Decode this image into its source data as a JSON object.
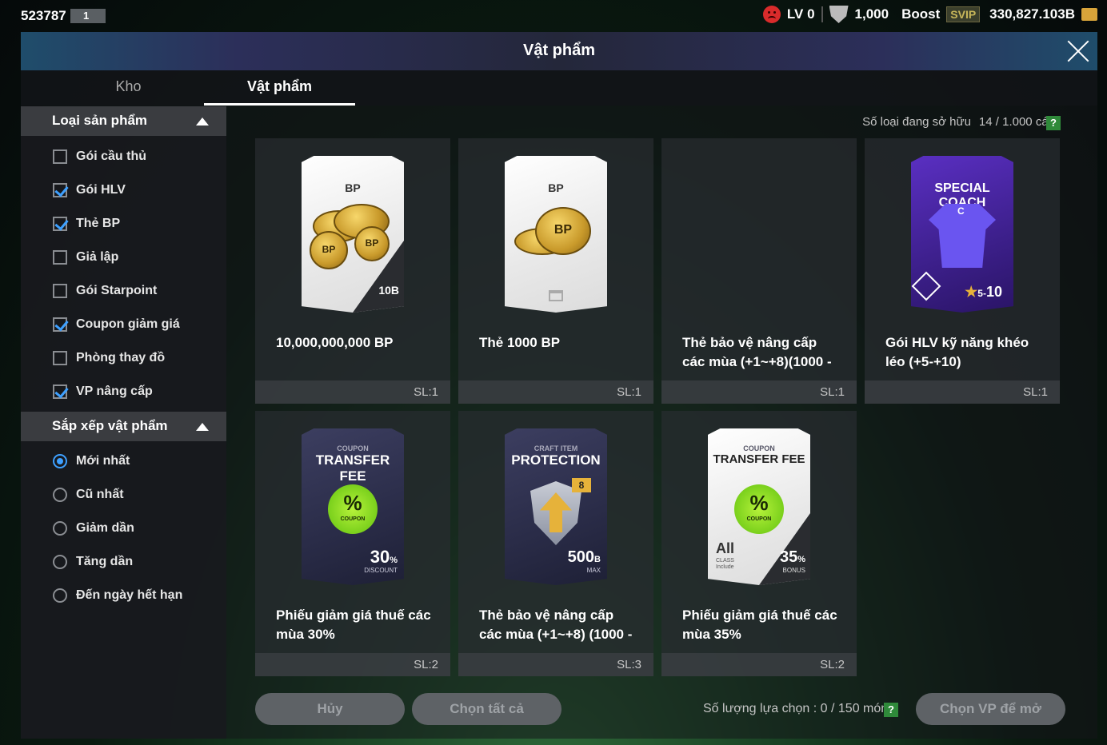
{
  "topbar": {
    "user_id": "523787",
    "slot": "1",
    "level": "LV 0",
    "trophy_count": "1,000",
    "boost_label": "Boost",
    "svip_label": "SVIP",
    "bp_balance": "330,827.103B"
  },
  "window": {
    "title": "Vật phẩm"
  },
  "tabs": [
    {
      "label": "Kho"
    },
    {
      "label": "Vật phẩm"
    }
  ],
  "filter": {
    "title": "Loại sản phẩm",
    "options": [
      {
        "label": "Gói cầu thủ",
        "checked": false
      },
      {
        "label": "Gói HLV",
        "checked": true
      },
      {
        "label": "Thẻ BP",
        "checked": true
      },
      {
        "label": "Giả lập",
        "checked": false
      },
      {
        "label": "Gói Starpoint",
        "checked": false
      },
      {
        "label": "Coupon giảm giá",
        "checked": true
      },
      {
        "label": "Phòng thay đồ",
        "checked": false
      },
      {
        "label": "VP nâng cấp",
        "checked": true
      }
    ]
  },
  "sort": {
    "title": "Sắp xếp vật phẩm",
    "options": [
      {
        "label": "Mới nhất",
        "selected": true
      },
      {
        "label": "Cũ nhất",
        "selected": false
      },
      {
        "label": "Giảm dần",
        "selected": false
      },
      {
        "label": "Tăng dần",
        "selected": false
      },
      {
        "label": "Đến ngày hết hạn",
        "selected": false
      }
    ]
  },
  "ownership": {
    "label": "Số loại đang sở hữu",
    "value": "14 / 1.000 cái",
    "help": "?"
  },
  "items": [
    {
      "name": "10,000,000,000 BP",
      "qty": "SL:1",
      "art_top": "BP",
      "art_value": "10B",
      "coin_text": "BP"
    },
    {
      "name": "Thẻ 1000 BP",
      "qty": "SL:1",
      "art_top": "BP",
      "coin_text": "BP"
    },
    {
      "name": "Thẻ bảo vệ nâng cấp các mùa (+1~+8)(1000 -",
      "qty": "SL:1"
    },
    {
      "name": "Gói HLV kỹ năng khéo léo (+5-+10)",
      "qty": "SL:1",
      "art_top": "SPECIAL COACH",
      "art_shirt_letter": "C",
      "art_range_small": "5-",
      "art_range": "10"
    },
    {
      "name": "Phiếu giảm giá thuế các mùa 30%",
      "qty": "SL:2",
      "art_small": "COUPON",
      "art_top": "TRANSFER FEE",
      "badge": "%",
      "badge_sub": "COUPON",
      "art_value": "30",
      "art_unit": "%",
      "art_sub": "DISCOUNT"
    },
    {
      "name": "Thẻ bảo vệ nâng cấp các mùa (+1~+8) (1000 -",
      "qty": "SL:3",
      "art_small": "CRAFT ITEM",
      "art_top": "PROTECTION",
      "art_tag": "8",
      "art_value": "500",
      "art_unit": "B",
      "art_sub": "MAX"
    },
    {
      "name": "Phiếu giảm giá thuế các mùa 35%",
      "qty": "SL:2",
      "art_small": "COUPON",
      "art_top": "TRANSFER FEE",
      "badge": "%",
      "badge_sub": "COUPON",
      "art_left": "All",
      "art_left_sub1": "CLASS",
      "art_left_sub2": "Include",
      "art_value": "35",
      "art_unit": "%",
      "art_sub": "BONUS"
    }
  ],
  "bottom": {
    "cancel_label": "Hủy",
    "select_all_label": "Chọn tất cả",
    "selection_label": "Số lượng lựa chọn : 0 / 150 món",
    "help": "?",
    "open_label": "Chọn VP để mở"
  }
}
